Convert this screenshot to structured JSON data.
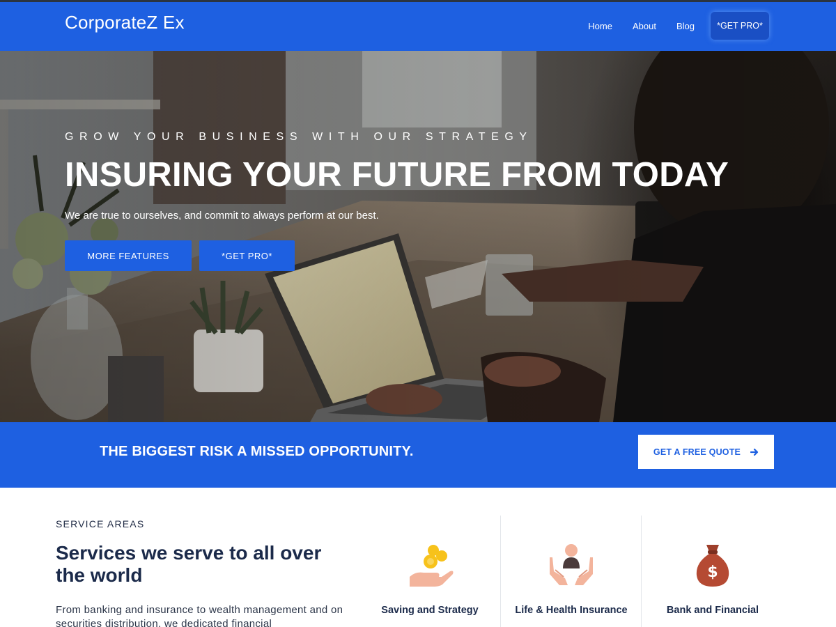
{
  "header": {
    "brand": "CorporateZ Ex",
    "nav": [
      {
        "label": "Home"
      },
      {
        "label": "About"
      },
      {
        "label": "Blog"
      },
      {
        "label": "*GET PRO*"
      }
    ]
  },
  "hero": {
    "kicker": "GROW YOUR BUSINESS WITH OUR STRATEGY",
    "title": "INSURING YOUR FUTURE FROM TODAY",
    "subtitle": "We are true to ourselves, and commit to always perform at our best.",
    "buttons": [
      {
        "label": "MORE FEATURES"
      },
      {
        "label": "*GET PRO*"
      }
    ]
  },
  "cta": {
    "text": "THE BIGGEST RISK A MISSED OPPORTUNITY.",
    "button_label": "GET A FREE QUOTE",
    "button_icon": "arrow-right-icon"
  },
  "services": {
    "kicker": "SERVICE AREAS",
    "title": "Services we serve to all over the world",
    "description": "From banking and insurance to wealth management and on securities distribution, we dedicated financial",
    "items": [
      {
        "label": "Saving and Strategy",
        "icon": "coins-hand-icon"
      },
      {
        "label": "Life & Health Insurance",
        "icon": "person-hands-icon"
      },
      {
        "label": "Bank and Financial",
        "icon": "money-bag-icon"
      }
    ]
  },
  "colors": {
    "primary": "#1e60e1",
    "dark_text": "#1b2a4a",
    "icon_peach": "#f3b49c",
    "icon_gold": "#f7c21b",
    "icon_brown": "#b54a33"
  }
}
